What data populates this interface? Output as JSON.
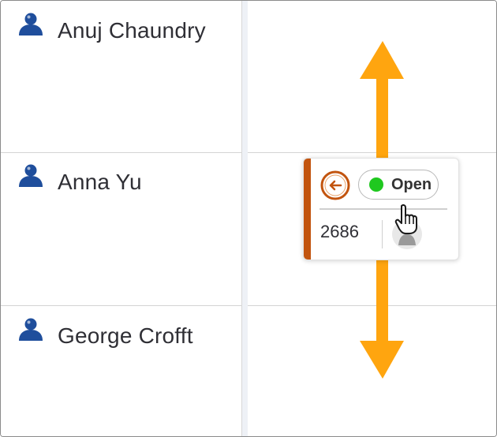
{
  "rows": [
    {
      "name": "Anuj Chaundry"
    },
    {
      "name": "Anna Yu"
    },
    {
      "name": "George Crofft"
    }
  ],
  "card": {
    "status_label": "Open",
    "status_color": "#1fc81f",
    "number": "2686",
    "accent_color": "#c2540e",
    "back_icon": "arrow-left-icon",
    "avatar_icon": "user-avatar-icon"
  },
  "colors": {
    "person_icon": "#1f4e9c",
    "arrow": "#ffa50f"
  }
}
